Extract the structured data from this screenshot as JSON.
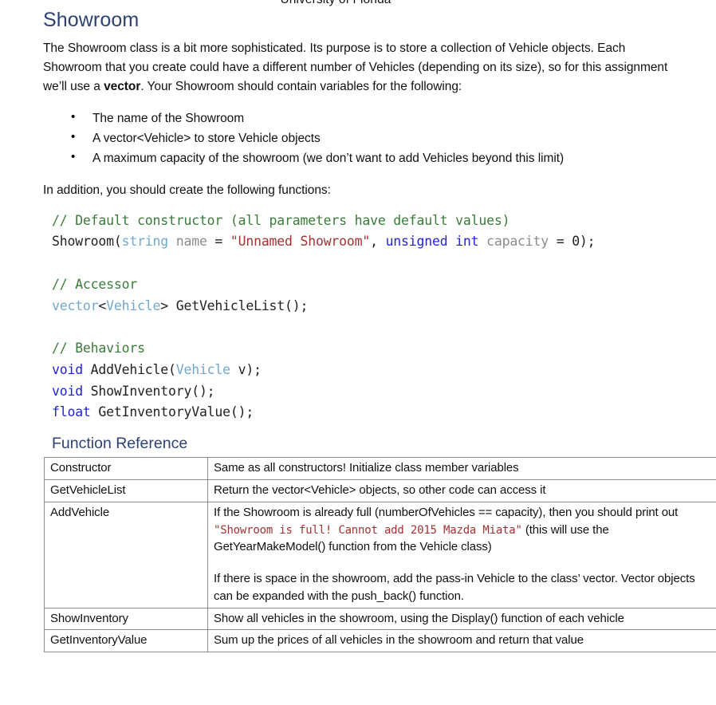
{
  "header": {
    "running_title": "University of Florida"
  },
  "document": {
    "title": "Showroom",
    "intro_paragraph": "The Showroom class is a bit more sophisticated. Its purpose is to store a collection of Vehicle objects. Each Showroom that you create could have a different number of Vehicles (depending on its size), so for this assignment we’ll use a ",
    "intro_bold_word": "vector",
    "intro_paragraph_tail": ". Your Showroom should contain variables for the following:",
    "bullets": [
      "The name of the Showroom",
      "A vector<Vehicle> to store Vehicle objects",
      "A maximum capacity of the showroom (we don’t want to add Vehicles beyond this limit)"
    ],
    "functions_intro": "In addition, you should create the following functions:"
  },
  "code": {
    "constructor_comment": "// Default constructor (all parameters have default values)",
    "constructor_name": "Showroom(",
    "constructor_kw_string": "string",
    "constructor_param_name": " name",
    "constructor_eq1": " = ",
    "constructor_default_name": "\"Unnamed Showroom\"",
    "constructor_comma": ", ",
    "constructor_kw_unsigned": "unsigned int",
    "constructor_param_capacity": " capacity",
    "constructor_eq2": " = ",
    "constructor_default_capacity": "0);",
    "accessor_comment": "// Accessor",
    "accessor_type_vector": "vector",
    "accessor_lt": "<",
    "accessor_type_vehicle": "Vehicle",
    "accessor_gt": "> ",
    "accessor_signature": "GetVehicleList();",
    "behaviors_comment": "// Behaviors",
    "behavior1_kw": "void",
    "behavior1_name": " AddVehicle(",
    "behavior1_type": "Vehicle",
    "behavior1_tail": " v);",
    "behavior2_kw": "void",
    "behavior2_name": " ShowInventory();",
    "behavior3_kw": "float",
    "behavior3_name": " GetInventoryValue();"
  },
  "reference": {
    "section_title": "Function Reference",
    "rows": [
      {
        "name": "Constructor",
        "desc": "Same as all constructors! Initialize class member variables"
      },
      {
        "name": "GetVehicleList",
        "desc": "Return the vector<Vehicle> objects, so other code can access it"
      },
      {
        "name": "AddVehicle",
        "desc_part1": "If the Showroom is already full (numberOfVehicles == capacity), then you should print out ",
        "desc_code": "\"Showroom is full! Cannot add 2015 Mazda Miata\"",
        "desc_part2": " (this will use the GetYearMakeModel() function from the Vehicle class)",
        "desc_part3": "If there is space in the showroom, add the pass-in Vehicle to the class’ vector. Vector objects can be expanded with the push_back() function."
      },
      {
        "name": "ShowInventory",
        "desc": "Show all vehicles in the showroom, using the Display() function of each vehicle"
      },
      {
        "name": "GetInventoryValue",
        "desc": "Sum up the prices of all vehicles in the showroom and return that value"
      }
    ]
  },
  "colors": {
    "heading": "#2e4272",
    "code_comment": "#3c7a3c",
    "code_keyword": "#2222dd",
    "code_type": "#6fa8cf",
    "code_string": "#a33232",
    "code_identifier": "#8c8c8c",
    "table_border": "#8f8f8f"
  }
}
